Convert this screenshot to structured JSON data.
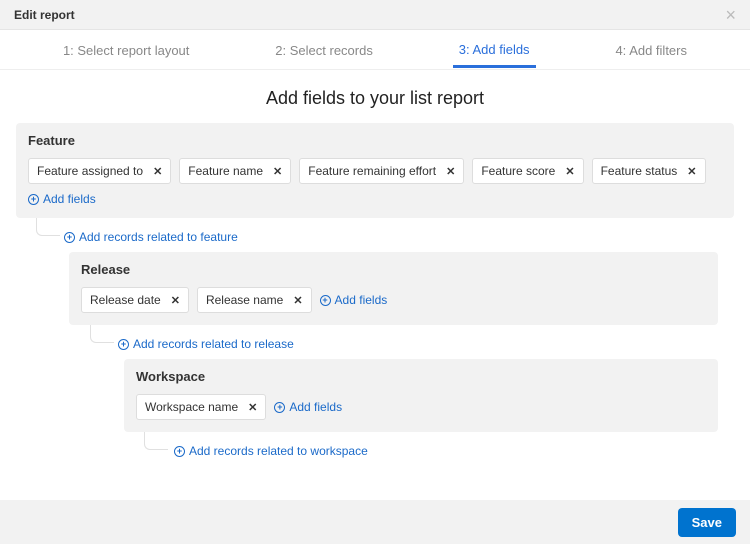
{
  "header": {
    "title": "Edit report"
  },
  "tabs": {
    "t1": "1: Select report layout",
    "t2": "2: Select records",
    "t3": "3: Add fields",
    "t4": "4: Add filters"
  },
  "heading": "Add fields to your list report",
  "labels": {
    "add_fields": "Add fields",
    "add_related_feature": "Add records related to feature",
    "add_related_release": "Add records related to release",
    "add_related_workspace": "Add records related to workspace"
  },
  "sections": {
    "feature": {
      "title": "Feature",
      "fields": {
        "f0": "Feature assigned to",
        "f1": "Feature name",
        "f2": "Feature remaining effort",
        "f3": "Feature score",
        "f4": "Feature status"
      }
    },
    "release": {
      "title": "Release",
      "fields": {
        "f0": "Release date",
        "f1": "Release name"
      }
    },
    "workspace": {
      "title": "Workspace",
      "fields": {
        "f0": "Workspace name"
      }
    }
  },
  "footer": {
    "save": "Save"
  }
}
